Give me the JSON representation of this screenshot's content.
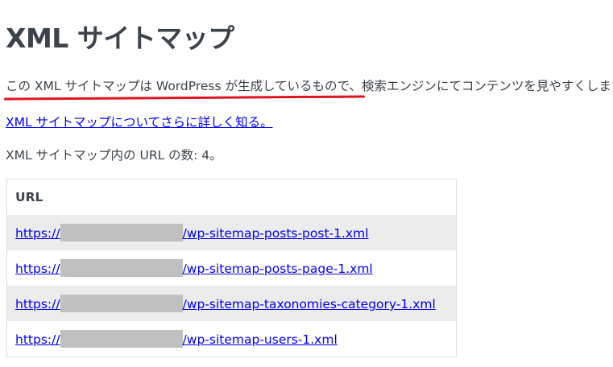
{
  "page": {
    "title": "XML サイトマップ",
    "description_highlighted": "この XML サイトマップは WordPress が生成しているもので、",
    "description_rest": "検索エンジンにてコンテンツを見やすくします。",
    "learn_more_link": "XML サイトマップについてさらに詳しく知る。",
    "url_count_text": "XML サイトマップ内の URL の数: 4。"
  },
  "table": {
    "header": "URL",
    "rows": [
      {
        "prefix": "https://",
        "suffix": "/wp-sitemap-posts-post-1.xml"
      },
      {
        "prefix": "https://",
        "suffix": "/wp-sitemap-posts-page-1.xml"
      },
      {
        "prefix": "https://",
        "suffix": "/wp-sitemap-taxonomies-category-1.xml"
      },
      {
        "prefix": "https://",
        "suffix": "/wp-sitemap-users-1.xml"
      }
    ]
  },
  "colors": {
    "text": "#3c434a",
    "link": "#0000ee",
    "annotation_underline": "#e0141e",
    "row_alt": "#ececec",
    "redaction": "#c0c0c0"
  }
}
